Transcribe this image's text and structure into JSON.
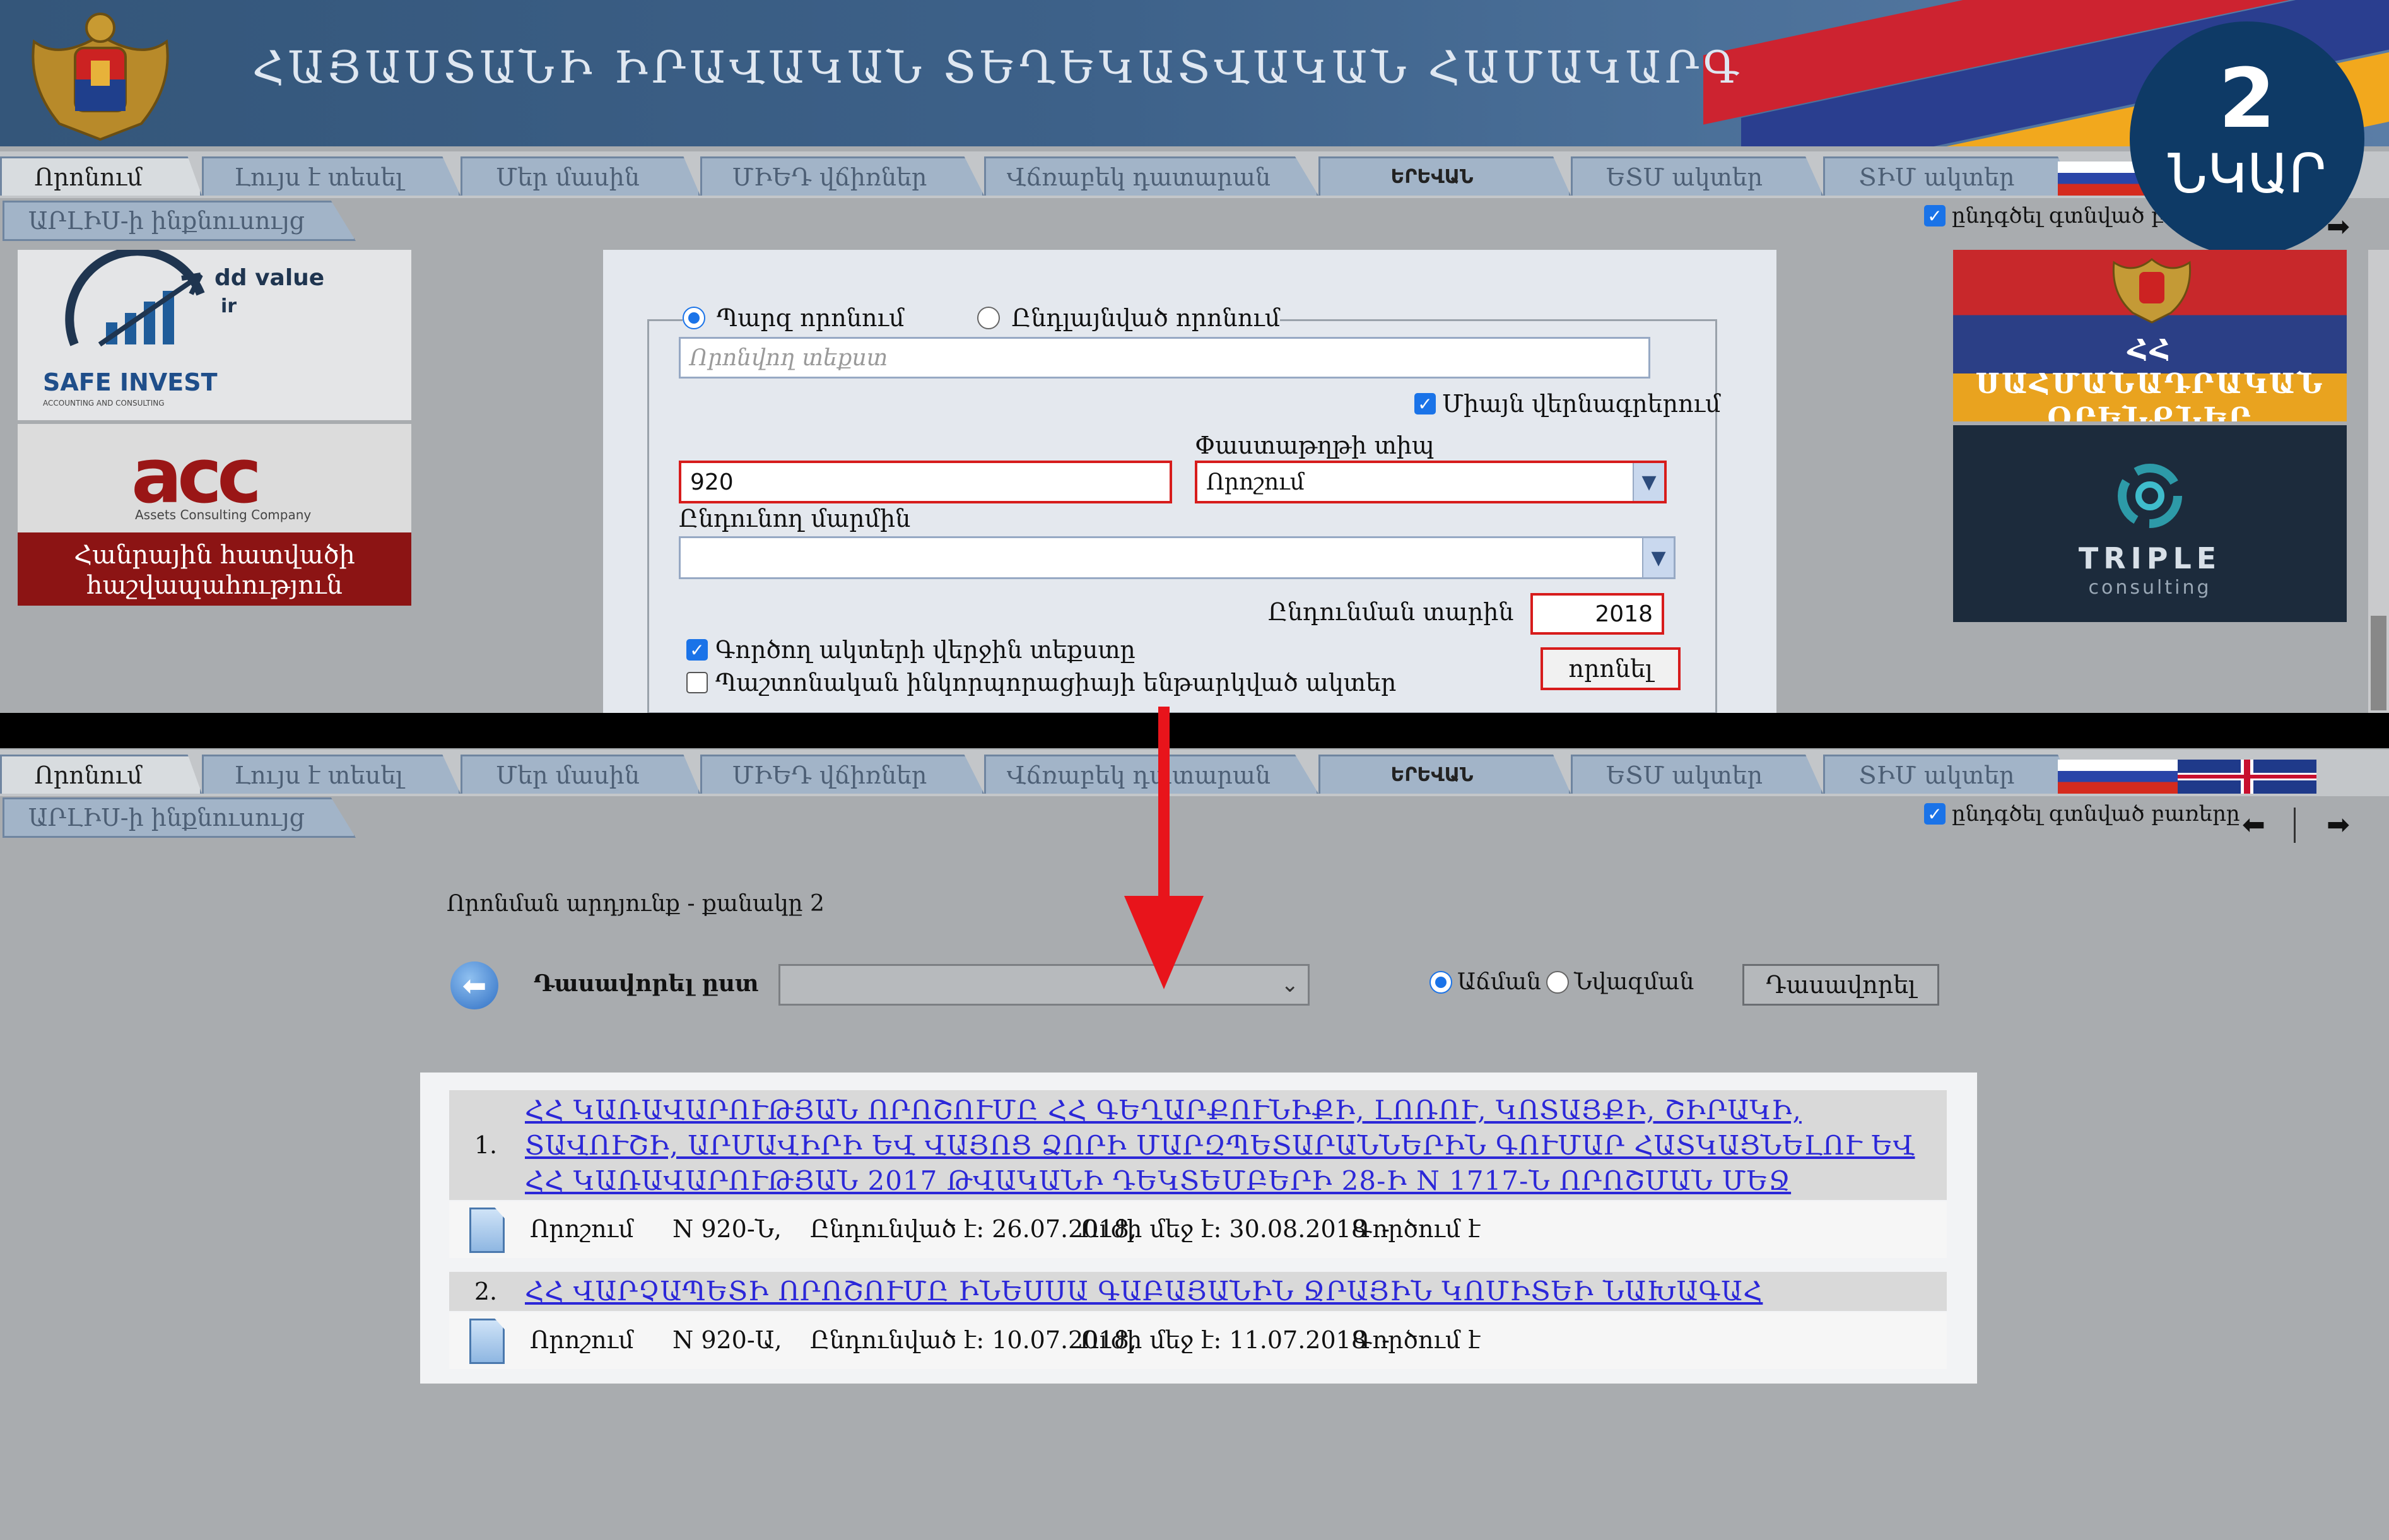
{
  "header": {
    "title": "ՀԱՅԱՍՏԱՆԻ ԻՐԱՎԱԿԱՆ ՏԵՂԵԿԱՏՎԱԿԱՆ ՀԱՄԱԿԱՐԳ",
    "badge_number": "2",
    "badge_label": "ՆԿԱՐ"
  },
  "tabs": [
    {
      "label": "Որոնում"
    },
    {
      "label": "Լույս է տեսել"
    },
    {
      "label": "Մեր մասին"
    },
    {
      "label": "ՄԻԵԴ վճիռներ"
    },
    {
      "label": "Վճռաբեկ դատարան"
    },
    {
      "label": "ԵՐԵՎԱՆ"
    },
    {
      "label": "ԵՏՄ ակտեր"
    },
    {
      "label": "ՏԻՄ ակտեր"
    }
  ],
  "subtab": {
    "label": "ԱՐԼԻՍ-ի ինքնուսույց"
  },
  "highlight_words": {
    "label": "ընդգծել գտնված բառերը"
  },
  "ads_left": {
    "safe_invest_tagline": "dd value",
    "safe_invest_tagline2": "ir",
    "safe_invest_name": "SAFE INVEST",
    "safe_invest_sub": "ACCOUNTING AND CONSULTING",
    "acc_logo": "acc",
    "acc_sub": "Assets Consulting Company",
    "acc_banner_1": "Հանրային հատվածի",
    "acc_banner_2": "հաշվապահություն"
  },
  "ads_right": {
    "constitution_1": "ՀՀ ՍԱՀՄԱՆԱԴՐԱԿԱՆ",
    "constitution_2": "ՕՐԵՆՔՆԵՐ",
    "triple_1": "TRIPLE",
    "triple_2": "consulting"
  },
  "search_form": {
    "radio_simple": "Պարզ որոնում",
    "radio_extended": "Ընդլայնված որոնում",
    "search_placeholder": "Որոնվող տեքստ",
    "titles_only": "Միայն վերնագրերում",
    "number_value": "920",
    "doc_type_label": "Փաստաթղթի տիպ",
    "doc_type_value": "Որոշում",
    "adopter_label": "Ընդունող մարմին",
    "adopter_value": "",
    "year_label": "Ընդունման տարին",
    "year_value": "2018",
    "current_texts": "Գործող ակտերի վերջին տեքստը",
    "official_incorp": "Պաշտոնական ինկորպորացիայի ենթարկված ակտեր",
    "search_button": "որոնել"
  },
  "results_page": {
    "count_text": "Որոնման արդյունք - քանակը 2",
    "sort_by_label": "Դասավորել ըստ",
    "sort_select_value": "",
    "asc_label": "Աճման",
    "desc_label": "Նվազման",
    "sort_button": "Դասավորել"
  },
  "results": [
    {
      "index": "1.",
      "title": "ՀՀ ԿԱՌԱՎԱՐՈՒԹՅԱՆ ՈՐՈՇՈՒՄԸ ՀՀ ԳԵՂԱՐՔՈՒՆԻՔԻ, ԼՈՌՈՒ, ԿՈՏԱՅՔԻ, ՇԻՐԱԿԻ, ՏԱՎՈՒՇԻ, ԱՐՄԱՎԻՐԻ ԵՎ ՎԱՅՈՑ ՁՈՐԻ ՄԱՐԶՊԵՏԱՐԱՆՆԵՐԻՆ ԳՈՒՄԱՐ ՀԱՏԿԱՑՆԵԼՈՒ ԵՎ ՀՀ ԿԱՌԱՎԱՐՈՒԹՅԱՆ 2017 ԹՎԱԿԱՆԻ ԴԵԿՏԵՄԲԵՐԻ 28-Ի N 1717-Ն ՈՐՈՇՄԱՆ ՄԵՋ ԼՐԱՑՈՒՄՆԵՐ ԿԱՏԱՐԵԼՈՒ ՄԱՍԻՆ",
      "type": "Որոշում",
      "number": "N 920-Ն,",
      "adopted": "Ընդունված է: 26.07.2018,",
      "in_force": "Ուժի մեջ է: 30.08.2018  -",
      "status": "Գործում է"
    },
    {
      "index": "2.",
      "title": "ՀՀ ՎԱՐՉԱՊԵՏԻ ՈՐՈՇՈՒՄԸ ԻՆԵՍՍԱ ԳԱԲԱՅԱՆԻՆ ՋՐԱՅԻՆ ԿՈՄԻՏԵԻ ՆԱԽԱԳԱՀ ՆՇԱՆԱԿԵԼՈՒ ՄԱՍԻՆ",
      "type": "Որոշում",
      "number": "N 920-Ա,",
      "adopted": "Ընդունված է: 10.07.2018,",
      "in_force": "Ուժի մեջ է: 11.07.2018  -",
      "status": "Գործում է"
    }
  ],
  "colors": {
    "header_blue": "#3d6189",
    "highlight_red": "#d71c1c",
    "badge": "#0e3a66",
    "link": "#2b27d8"
  }
}
